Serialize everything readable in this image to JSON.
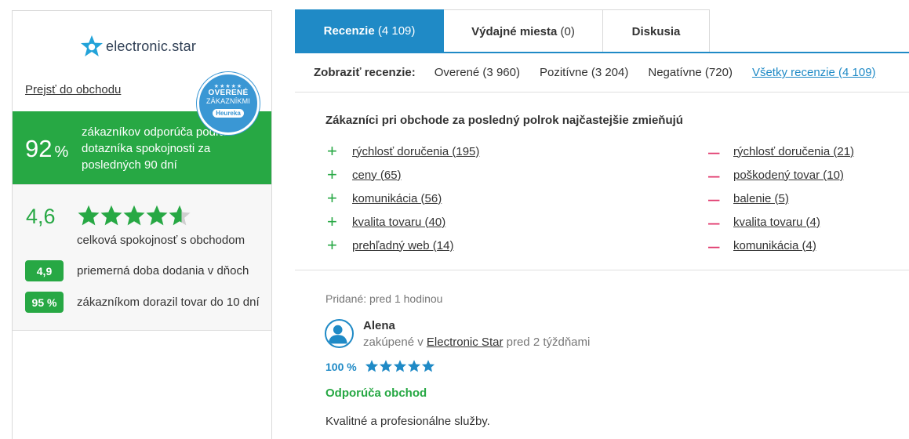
{
  "sidebar": {
    "logo_text": "electronic.star",
    "shop_link": "Prejsť do obchodu",
    "badge": {
      "stars": "★★★★★",
      "line1": "OVERENÉ",
      "line2": "ZÁKAZNÍKMI",
      "brand": "Heureka"
    },
    "recommend": {
      "percent": "92",
      "percent_unit": "%",
      "text": "zákazníkov odporúča podľa dotazníka spokojnosti za posledných 90 dní"
    },
    "rating": {
      "value": "4,6",
      "stars": 4.6,
      "label": "celková spokojnosť s obchodom"
    },
    "stats": [
      {
        "value": "4,9",
        "label": "priemerná doba dodania v dňoch"
      },
      {
        "value": "95 %",
        "label": "zákazníkom dorazil tovar do 10 dní"
      }
    ]
  },
  "tabs": [
    {
      "label": "Recenzie",
      "count": "(4 109)",
      "active": true
    },
    {
      "label": "Výdajné miesta",
      "count": "(0)",
      "active": false
    },
    {
      "label": "Diskusia",
      "count": "",
      "active": false
    }
  ],
  "filters": {
    "label": "Zobraziť recenzie:",
    "options": [
      {
        "label": "Overené (3 960)",
        "link": false
      },
      {
        "label": "Pozitívne (3 204)",
        "link": false
      },
      {
        "label": "Negatívne (720)",
        "link": false
      },
      {
        "label": "Všetky recenzie (4 109)",
        "link": true
      }
    ]
  },
  "mentions": {
    "title": "Zákazníci pri obchode za posledný polrok najčastejšie zmieňujú",
    "positive_sign": "+",
    "negative_sign": "–",
    "positive": [
      "rýchlosť doručenia (195)",
      "ceny (65)",
      "komunikácia (56)",
      "kvalita tovaru (40)",
      "prehľadný web (14)"
    ],
    "negative": [
      "rýchlosť doručenia (21)",
      "poškodený tovar (10)",
      "balenie (5)",
      "kvalita tovaru (4)",
      "komunikácia (4)"
    ]
  },
  "review": {
    "added": "Pridané: pred 1 hodinou",
    "author": "Alena",
    "bought_prefix": "zakúpené v",
    "shop": "Electronic Star",
    "bought_suffix": "pred 2 týždňami",
    "percent": "100 %",
    "stars": 5,
    "recommend": "Odporúča obchod",
    "text": "Kvalitné a profesionálne služby."
  },
  "colors": {
    "green": "#27a844",
    "blue": "#1f8ac6",
    "pink": "#e0366b"
  }
}
